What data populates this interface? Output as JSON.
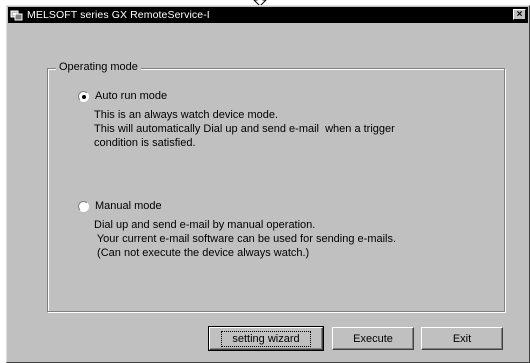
{
  "window": {
    "title": "MELSOFT series GX RemoteService-I",
    "close_label": "×"
  },
  "group": {
    "legend": "Operating mode"
  },
  "options": [
    {
      "label": "Auto run mode",
      "checked": true,
      "description": "This is an always watch device mode.\nThis will automatically Dial up and send e-mail  when a trigger\ncondition is satisfied."
    },
    {
      "label": "Manual mode",
      "checked": false,
      "description": "Dial up and send e-mail by manual operation.\n Your current e-mail software can be used for sending e-mails.\n (Can not execute the device always watch.)"
    }
  ],
  "buttons": {
    "wizard_label": "setting wizard",
    "execute_label": "Execute",
    "exit_label": "Exit"
  }
}
